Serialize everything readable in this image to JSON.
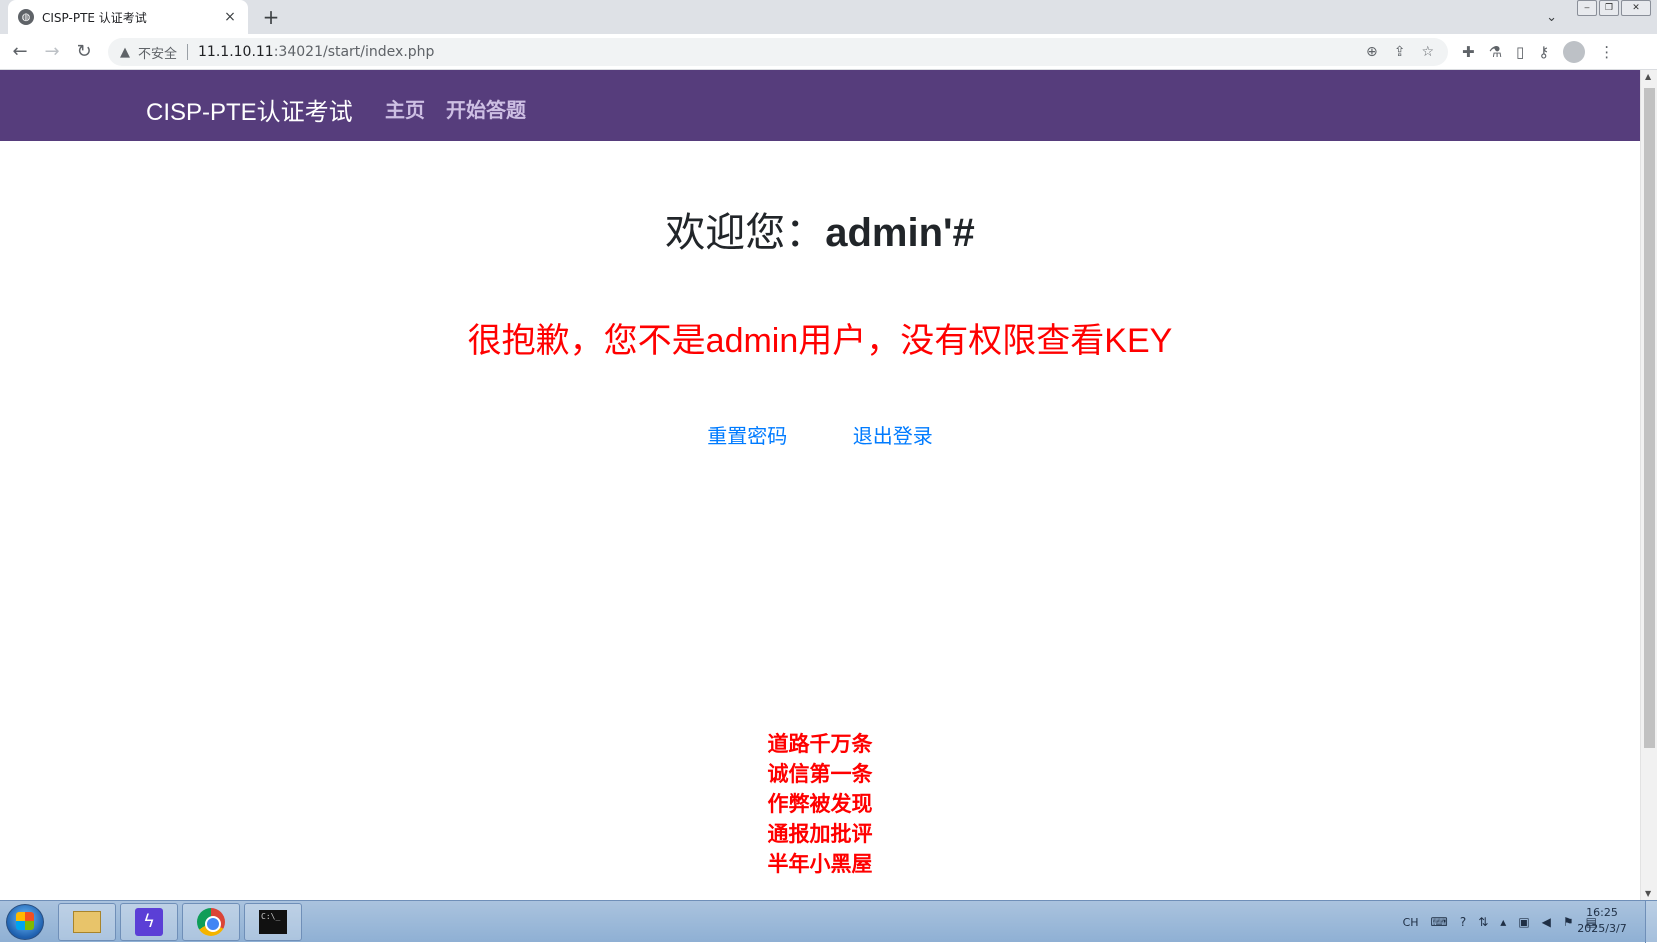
{
  "browser": {
    "tab_title": "CISP-PTE 认证考试",
    "tab_close": "×",
    "new_tab": "+",
    "tab_list": "⌄",
    "security_label": "不安全",
    "url_host": "11.1.10.11",
    "url_rest": ":34021/start/index.php",
    "icons": {
      "back": "back-arrow-icon",
      "forward": "forward-arrow-icon",
      "reload": "reload-icon",
      "warning": "warning-triangle-icon",
      "zoom": "zoom-icon",
      "share": "share-icon",
      "bookmark": "star-icon",
      "extensions": "puzzle-icon",
      "labs": "flask-icon",
      "sidepanel": "side-panel-icon",
      "key": "key-icon",
      "profile": "avatar-icon",
      "menu": "kebab-menu-icon"
    }
  },
  "navbar": {
    "brand": "CISP-PTE认证考试",
    "items": [
      {
        "label": "主页"
      },
      {
        "label": "开始答题"
      }
    ],
    "bg_color": "#563d7c"
  },
  "main": {
    "welcome_prefix": "欢迎您：",
    "username": "admin'#",
    "denied_message": "很抱歉，您不是admin用户，没有权限查看KEY",
    "links": [
      {
        "label": "重置密码"
      },
      {
        "label": "退出登录"
      }
    ],
    "motto": [
      "道路千万条",
      "诚信第一条",
      "作弊被发现",
      "通报加批评",
      "半年小黑屋"
    ],
    "message_color": "#ff0000",
    "link_color": "#007bff"
  },
  "taskbar": {
    "apps": [
      "file-explorer-icon",
      "bolt-app-icon",
      "chrome-icon",
      "cmd-icon"
    ],
    "lang": "CH",
    "time": "16:25",
    "date": "2025/3/7"
  }
}
